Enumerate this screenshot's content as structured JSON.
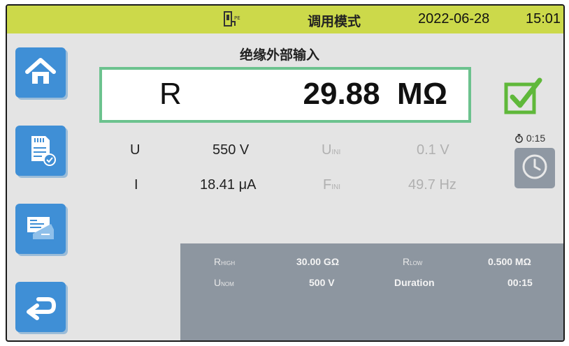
{
  "topbar": {
    "device_icon": "instrument-icon",
    "mode": "调用模式",
    "date": "2022-06-28",
    "time": "15:01",
    "accent": "#ccd94a"
  },
  "sidebar": {
    "items": [
      {
        "name": "home",
        "icon": "home-icon"
      },
      {
        "name": "save",
        "icon": "sd-card-save-icon"
      },
      {
        "name": "report",
        "icon": "report-icon"
      },
      {
        "name": "back",
        "icon": "return-arrow-icon"
      }
    ]
  },
  "measurement": {
    "title": "绝缘外部输入",
    "label": "R",
    "value": "29.88  MΩ",
    "status_icon": "check-icon",
    "status_color": "#5fb83a"
  },
  "timer": {
    "icon": "timer-icon",
    "text": "0:15",
    "button_icon": "clock-icon"
  },
  "readings": {
    "u_label": "U",
    "u_value": "550 V",
    "i_label": "I",
    "i_value": "18.41 μA",
    "uini_label": "U",
    "uini_sub": "INI",
    "uini_value": "0.1 V",
    "fini_label": "F",
    "fini_sub": "INI",
    "fini_value": "49.7 Hz"
  },
  "params": {
    "rhigh_label": "R",
    "rhigh_sub": "HIGH",
    "rhigh_value": "30.00 GΩ",
    "rlow_label": "R",
    "rlow_sub": "LOW",
    "rlow_value": "0.500 MΩ",
    "unom_label": "U",
    "unom_sub": "NOM",
    "unom_value": "500 V",
    "duration_label": "Duration",
    "duration_value": "00:15"
  }
}
